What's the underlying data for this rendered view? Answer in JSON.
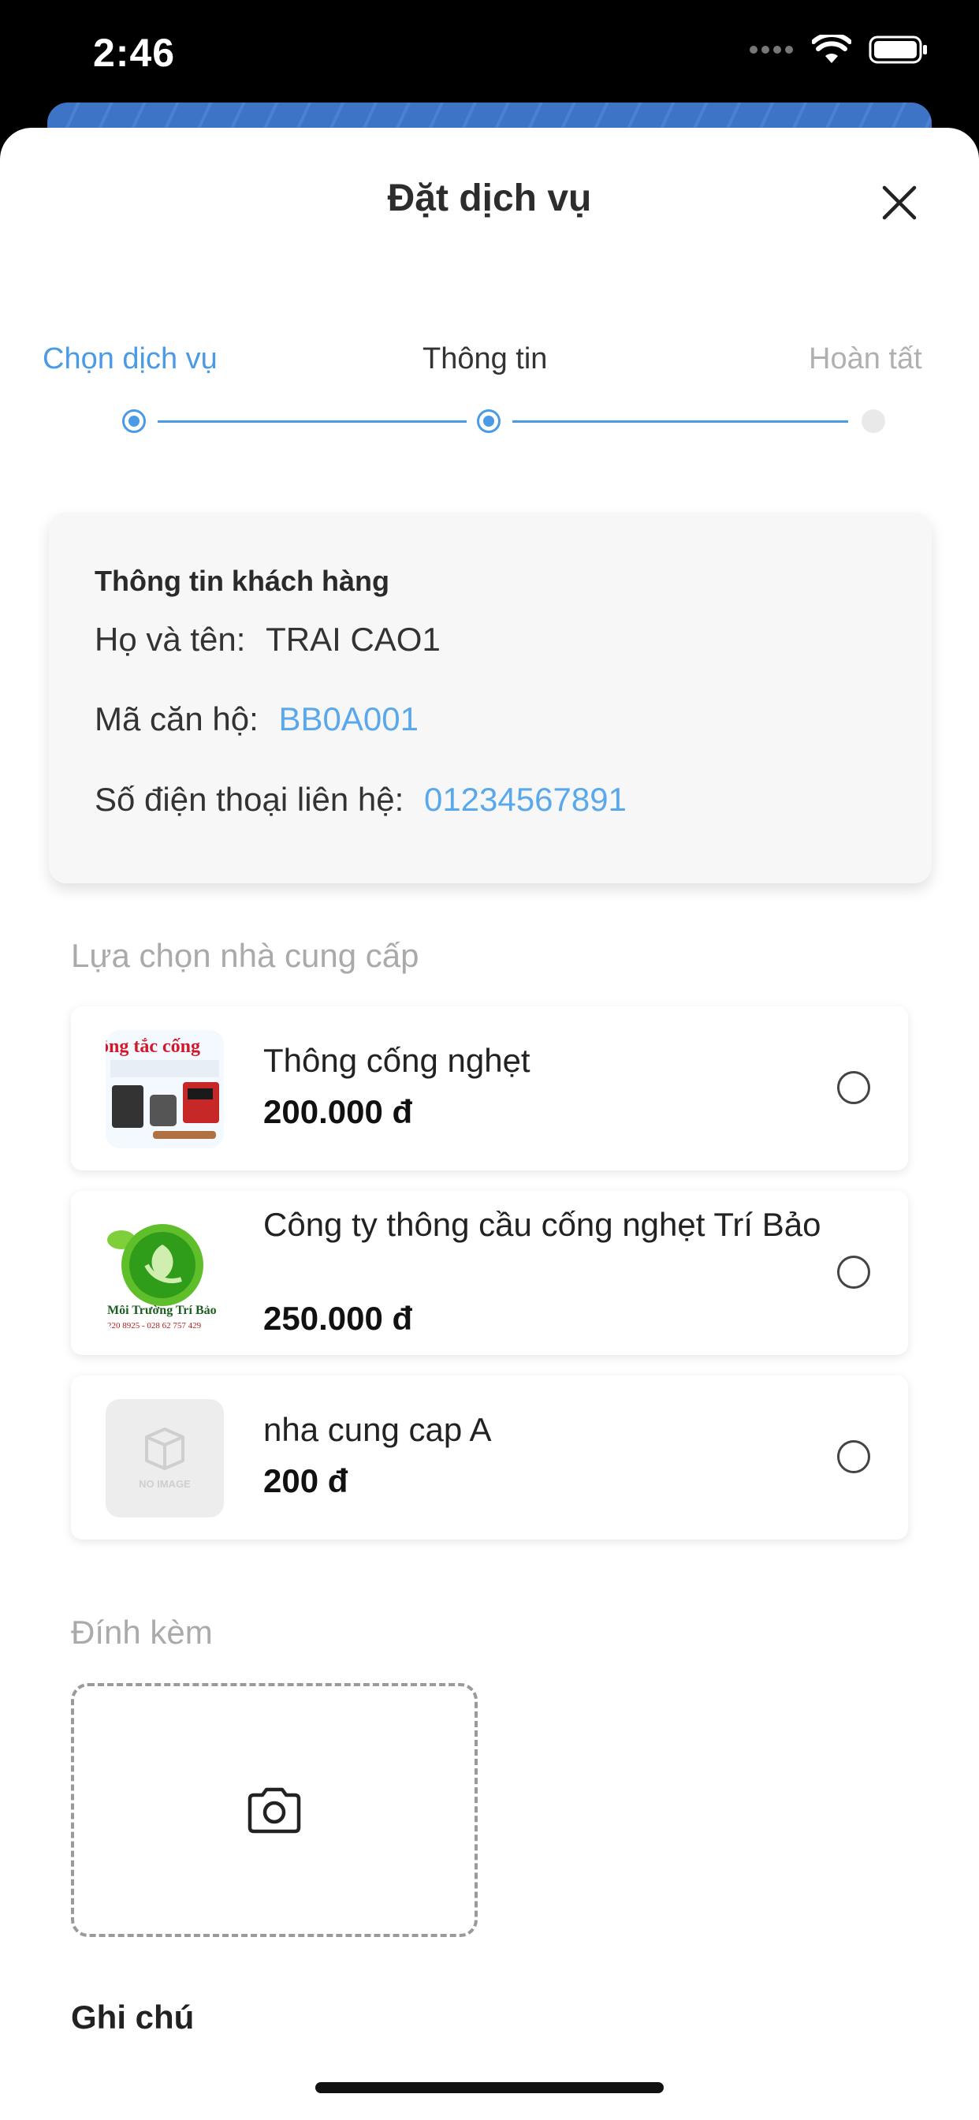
{
  "status_bar": {
    "time": "2:46"
  },
  "sheet": {
    "title": "Đặt dịch vụ"
  },
  "steps": [
    {
      "label": "Chọn dịch vụ",
      "state": "done"
    },
    {
      "label": "Thông tin",
      "state": "current"
    },
    {
      "label": "Hoàn tất",
      "state": "pending"
    }
  ],
  "customer": {
    "title": "Thông tin khách hàng",
    "name_label": "Họ và tên:",
    "name_value": "TRAI CAO1",
    "apartment_label": "Mã căn hộ:",
    "apartment_value": "BB0A001",
    "phone_label": "Số điện thoại liên hệ:",
    "phone_value": "01234567891"
  },
  "providers": {
    "section_label": "Lựa chọn nhà cung cấp",
    "items": [
      {
        "name": "Thông cống nghẹt",
        "price": "200.000 đ",
        "thumb_text": "ông tắc cống",
        "selected": false
      },
      {
        "name": "Công ty thông cầu cống nghẹt Trí Bảo",
        "price": "250.000 đ",
        "thumb_text": "Môi Trường Trí Bảo",
        "thumb_phone": "220 8925 - 028 62 757 429",
        "selected": false
      },
      {
        "name": "nha cung cap A",
        "price": "200 đ",
        "thumb_text": "NO IMAGE",
        "selected": false
      }
    ]
  },
  "attachment": {
    "label": "Đính kèm",
    "icon": "camera-icon"
  },
  "note": {
    "label": "Ghi chú"
  },
  "colors": {
    "accent": "#4a9be6",
    "link": "#5aa8ec",
    "muted": "#aaaaaa"
  }
}
